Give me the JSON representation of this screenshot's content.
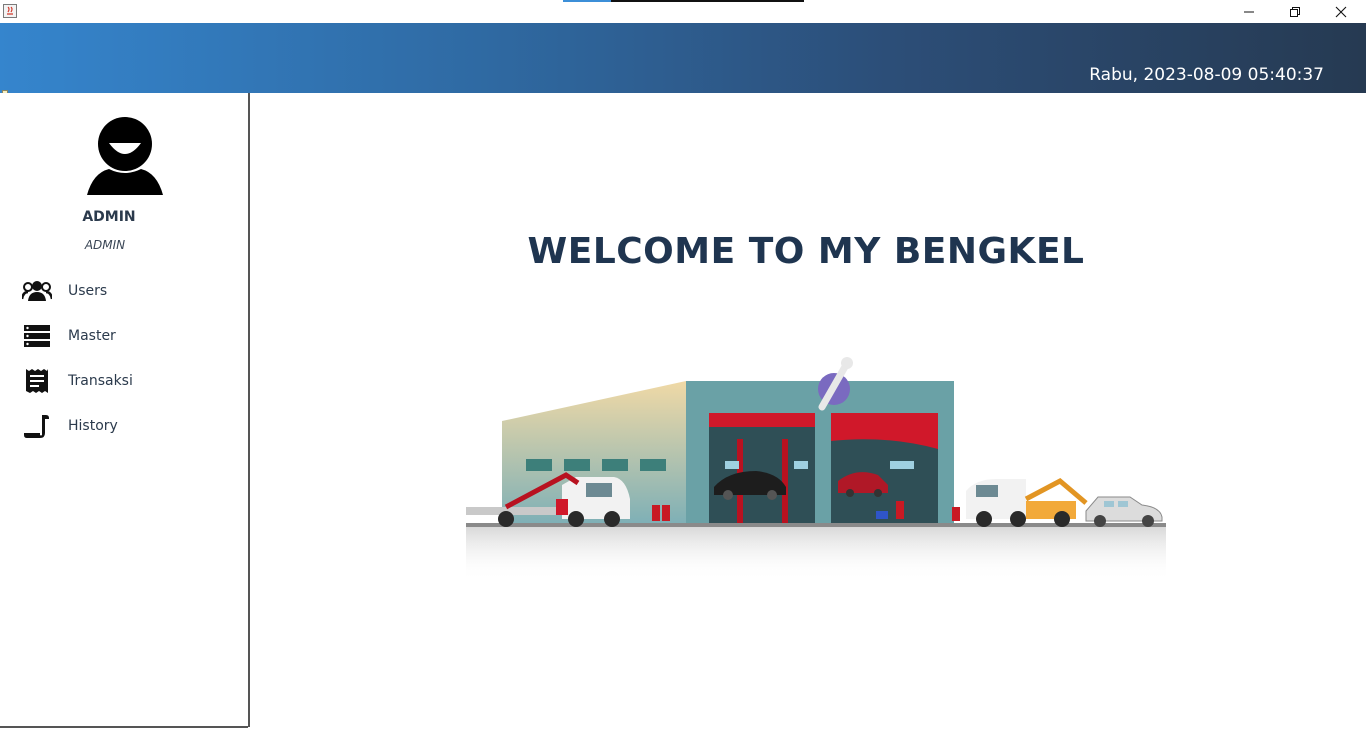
{
  "window": {
    "minimize_icon": "minimize-icon",
    "restore_icon": "restore-icon",
    "close_icon": "close-icon",
    "title_progress": 0.2
  },
  "header": {
    "datetime": "Rabu, 2023-08-09 05:40:37",
    "gradient_start": "#3585cd",
    "gradient_end": "#263a52"
  },
  "sidebar": {
    "user_name": "ADMIN",
    "user_role": "ADMIN",
    "items": [
      {
        "label": "Users",
        "icon": "users-icon"
      },
      {
        "label": "Master",
        "icon": "server-icon"
      },
      {
        "label": "Transaksi",
        "icon": "receipt-icon"
      },
      {
        "label": "History",
        "icon": "scroll-icon"
      }
    ]
  },
  "main": {
    "welcome": "WELCOME TO MY BENGKEL"
  }
}
